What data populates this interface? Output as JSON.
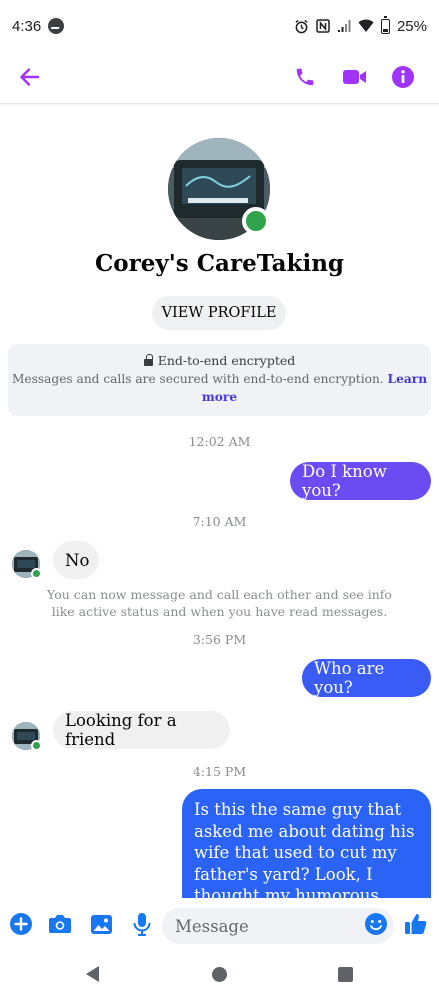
{
  "status_bar": {
    "time": "4:36",
    "battery": "25%"
  },
  "header": {
    "accent_color": "#a033ff"
  },
  "contact": {
    "name": "Corey's CareTaking",
    "view_profile_label": "VIEW PROFILE",
    "online": true
  },
  "encryption": {
    "title": "End-to-end encrypted",
    "body": "Messages and calls are secured with end-to-end encryption.",
    "link": "Learn more"
  },
  "messages": [
    {
      "timestamp": "12:02 AM"
    },
    {
      "direction": "out",
      "text": "Do I know you?",
      "color": "#6a4cf2"
    },
    {
      "timestamp": "7:10 AM"
    },
    {
      "direction": "in",
      "text": "No"
    },
    {
      "system": "You can now message and call each other and see info like active status and when you have read messages."
    },
    {
      "timestamp": "3:56 PM"
    },
    {
      "direction": "out",
      "text": "Who are you?",
      "color": "#3b5bf7"
    },
    {
      "direction": "in",
      "text": "Looking for a friend"
    },
    {
      "timestamp": "4:15 PM"
    },
    {
      "direction": "out",
      "text": "Is this the same guy that asked me about dating his wife that used to cut my father's yard? Look, I thought my humorous stranger",
      "color": "#2a63f5"
    }
  ],
  "composer": {
    "placeholder": "Message",
    "icon_color": "#1877f2"
  }
}
